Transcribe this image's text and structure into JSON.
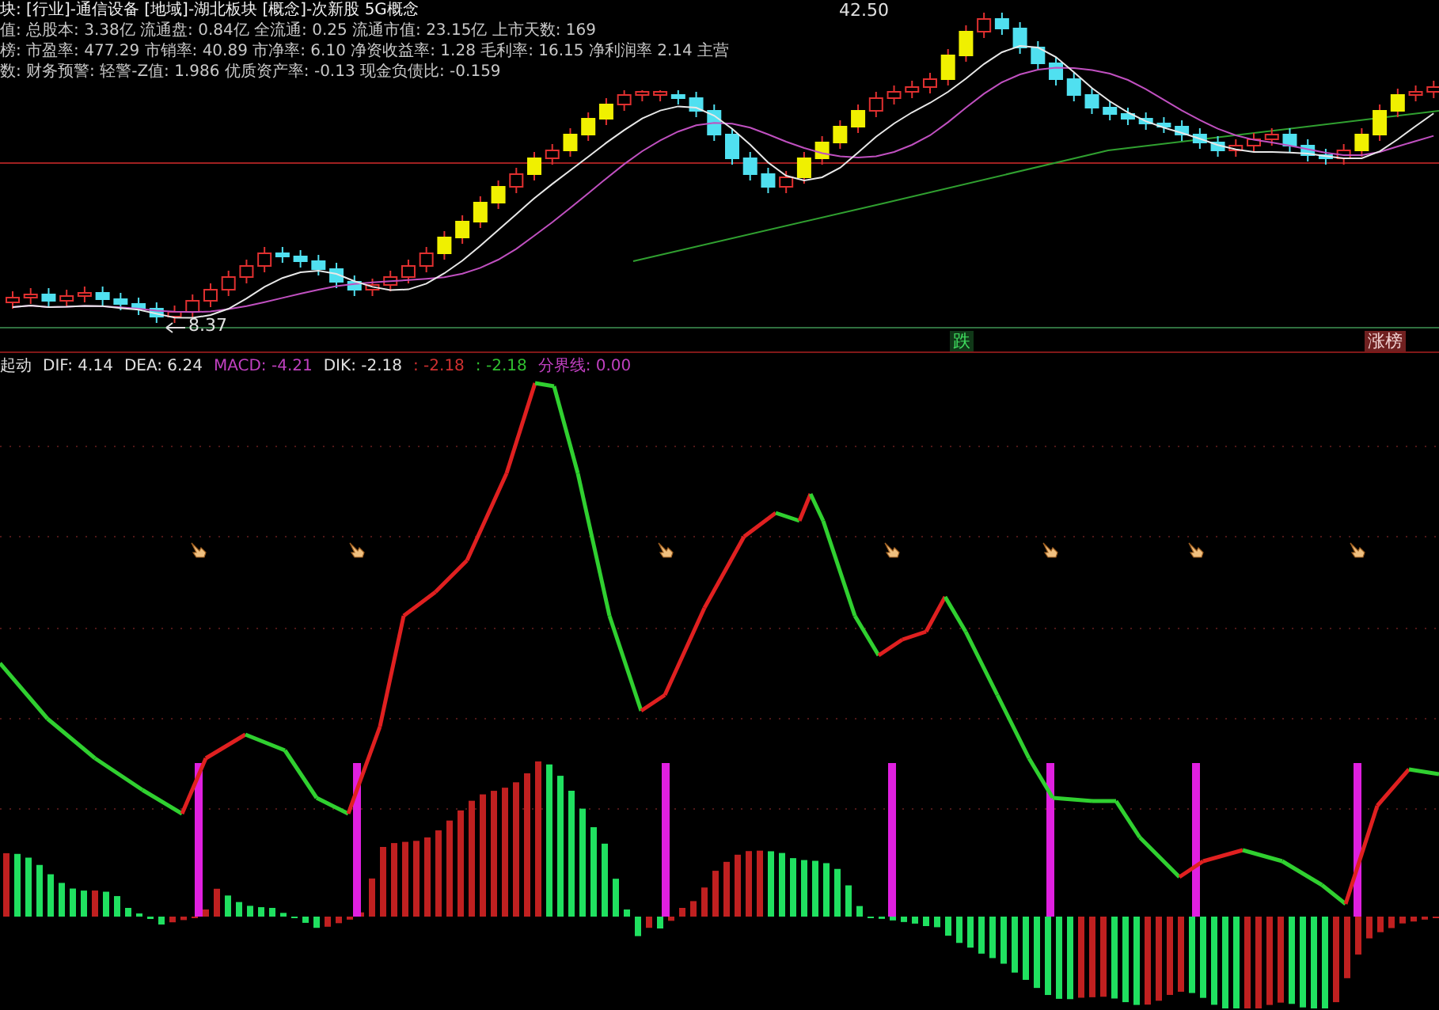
{
  "info_lines": [
    {
      "text": "块: [行业]-通信设备 [地域]-湖北板块 [概念]-次新股 5G概念",
      "color": "#f0f0f0"
    },
    {
      "text": "值: 总股本: 3.38亿 流通盘: 0.84亿 全流通: 0.25 流通市值: 23.15亿 上市天数: 169",
      "color": "#c8c8c8"
    },
    {
      "text": "榜: 市盈率: 477.29 市销率: 40.89 市净率: 6.10 净资收益率: 1.28 毛利率: 16.15 净利润率 2.14 主营",
      "color": "#c8c8c8"
    },
    {
      "text": "数: 财务预警: 轻警-Z值: 1.986 优质资产率: -0.13 现金负债比: -0.159",
      "color": "#c8c8c8"
    }
  ],
  "price_labels": {
    "high": "42.50",
    "low": "8.37"
  },
  "signals": [
    {
      "text": "跌",
      "kind": "fall"
    },
    {
      "text": "涨榜",
      "kind": "rise"
    }
  ],
  "indicator": {
    "name": "起动",
    "values": [
      {
        "text": "DIF: 4.14",
        "color": "#e0e0e0"
      },
      {
        "text": "DEA: 6.24",
        "color": "#e0e0e0"
      },
      {
        "text": "MACD: -4.21",
        "color": "#c040c0"
      },
      {
        "text": "DIK: -2.18",
        "color": "#e0e0e0"
      },
      {
        "text": ": -2.18",
        "color": "#d03030"
      },
      {
        "text": ": -2.18",
        "color": "#30c030"
      },
      {
        "text": "分界线: 0.00",
        "color": "#c040c0"
      }
    ]
  }
}
